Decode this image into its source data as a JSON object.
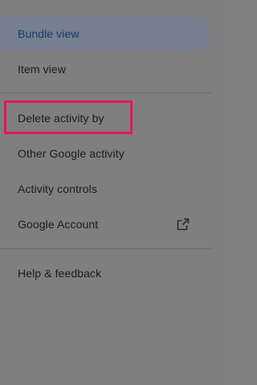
{
  "menu": {
    "items": [
      {
        "label": "Bundle view",
        "active": true
      },
      {
        "label": "Item view"
      },
      {
        "label": "Delete activity by"
      },
      {
        "label": "Other Google activity"
      },
      {
        "label": "Activity controls"
      },
      {
        "label": "Google Account",
        "icon": "open-in-new-icon"
      },
      {
        "label": "Help & feedback"
      }
    ]
  },
  "colors": {
    "overlay": "#7f7f7f",
    "active_pill": "#778090",
    "active_text": "#173a70",
    "highlight_border": "#e01a5a"
  }
}
